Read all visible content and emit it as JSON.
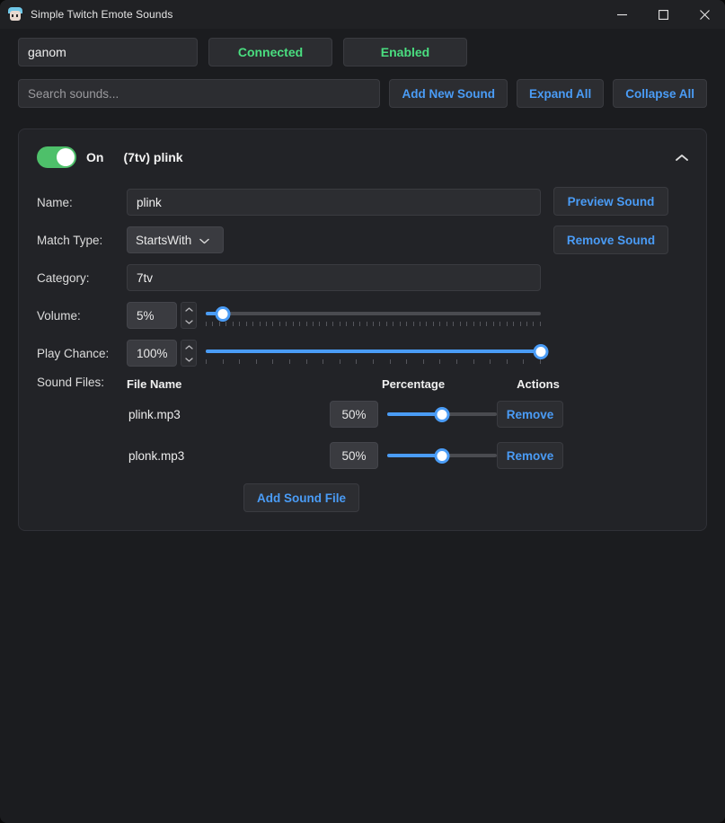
{
  "window": {
    "title": "Simple Twitch Emote Sounds",
    "app_icon": "twitch-emote-icon",
    "controls": {
      "minimize": "minimize-icon",
      "maximize": "maximize-icon",
      "close": "close-icon"
    }
  },
  "header": {
    "channel_value": "ganom",
    "channel_placeholder": "",
    "connection_status": "Connected",
    "enabled_status": "Enabled",
    "status_color": "#4ade80"
  },
  "toolbar": {
    "search_placeholder": "Search sounds...",
    "search_value": "",
    "add_new_sound": "Add New Sound",
    "expand_all": "Expand All",
    "collapse_all": "Collapse All",
    "accent_color": "#4a9cf6"
  },
  "sound_card": {
    "toggle_state": "On",
    "toggle_on": true,
    "title": "(7tv) plink",
    "collapse_icon": "chevron-up-icon",
    "fields": {
      "name_label": "Name:",
      "name_value": "plink",
      "match_type_label": "Match Type:",
      "match_type_value": "StartsWith",
      "category_label": "Category:",
      "category_value": "7tv",
      "volume_label": "Volume:",
      "volume_value": "5%",
      "volume_percent": 5,
      "play_chance_label": "Play Chance:",
      "play_chance_value": "100%",
      "play_chance_percent": 100
    },
    "actions": {
      "preview_sound": "Preview Sound",
      "remove_sound": "Remove Sound"
    },
    "sound_files": {
      "label": "Sound Files:",
      "columns": [
        "File Name",
        "Percentage",
        "Actions"
      ],
      "rows": [
        {
          "file_name": "plink.mp3",
          "percentage": "50%",
          "percent": 50,
          "action": "Remove"
        },
        {
          "file_name": "plonk.mp3",
          "percentage": "50%",
          "percent": 50,
          "action": "Remove"
        }
      ],
      "add_button": "Add Sound File"
    }
  }
}
